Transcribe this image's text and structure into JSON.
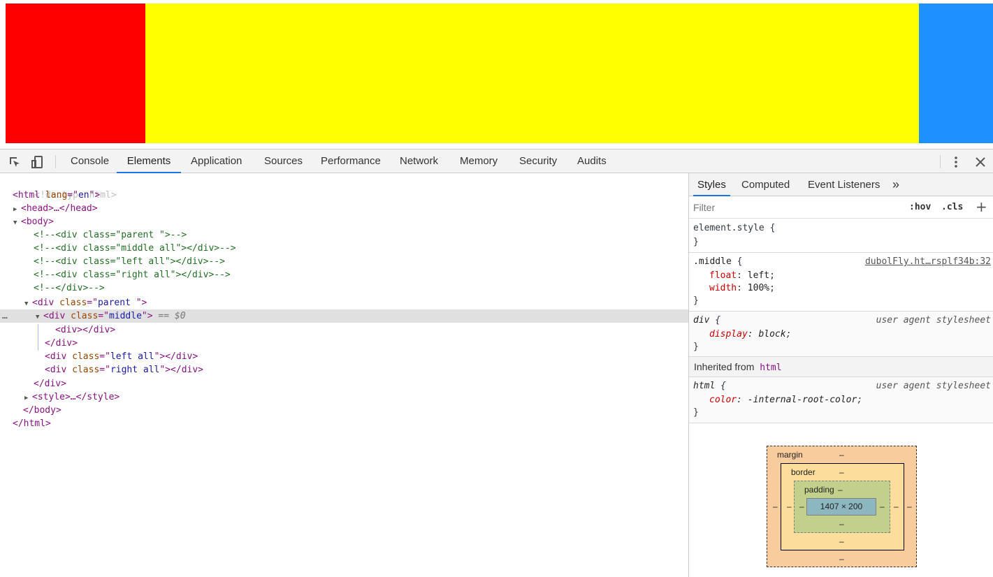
{
  "preview": {
    "colors": {
      "left": "#ff0000",
      "middle": "#ffff00",
      "right": "#1e90ff"
    }
  },
  "toolbar": {
    "tabs": [
      "Console",
      "Elements",
      "Application",
      "Sources",
      "Performance",
      "Network",
      "Memory",
      "Security",
      "Audits"
    ],
    "active_tab": "Elements",
    "icons": [
      "inspect-icon",
      "device-toggle-icon",
      "more-vertical-icon",
      "close-icon"
    ]
  },
  "elements": {
    "doctype": "<!doctype html>",
    "lines": {
      "html_open": {
        "tag": "html",
        "attr": "lang",
        "value": "en"
      },
      "head": "<head>…</head>",
      "body_open": "<body>",
      "comments": [
        "<!--<div class=\"parent \">-->",
        "<!--<div class=\"middle all\"></div>-->",
        "<!--<div class=\"left all\"></div>-->",
        "<!--<div class=\"right all\"></div>-->",
        "<!--</div>-->"
      ],
      "parent_open": {
        "attr": "class",
        "value": "parent "
      },
      "middle_open": {
        "attr": "class",
        "value": "middle"
      },
      "selected_suffix": "== $0",
      "inner_div": "<div></div>",
      "div_close": "</div>",
      "left_div": {
        "attr": "class",
        "value": "left all"
      },
      "right_div": {
        "attr": "class",
        "value": "right all"
      },
      "parent_close": "</div>",
      "style": "<style>…</style>",
      "body_close": "</body>",
      "html_close": "</html>"
    }
  },
  "sidebar": {
    "tabs": [
      "Styles",
      "Computed",
      "Event Listeners"
    ],
    "active_tab": "Styles",
    "more_tabs": "»",
    "filter_placeholder": "Filter",
    "hov": ":hov",
    "cls": ".cls",
    "plus": "+",
    "rules": {
      "element_style": {
        "selector": "element.style {",
        "close": "}"
      },
      "middle": {
        "selector": ".middle",
        "origin": "dubolFly.ht…rsplf34b:32",
        "props": [
          {
            "name": "float",
            "value": "left"
          },
          {
            "name": "width",
            "value": "100%"
          }
        ]
      },
      "div": {
        "selector": "div",
        "origin": "user agent stylesheet",
        "props": [
          {
            "name": "display",
            "value": "block"
          }
        ]
      },
      "inherited_label": "Inherited from",
      "inherited_tag": "html",
      "html": {
        "selector": "html",
        "origin": "user agent stylesheet",
        "props": [
          {
            "name": "color",
            "value": "-internal-root-color"
          }
        ]
      }
    },
    "box_model": {
      "margin_label": "margin",
      "border_label": "border",
      "padding_label": "padding",
      "dash": "–",
      "content": "1407 × 200"
    }
  }
}
